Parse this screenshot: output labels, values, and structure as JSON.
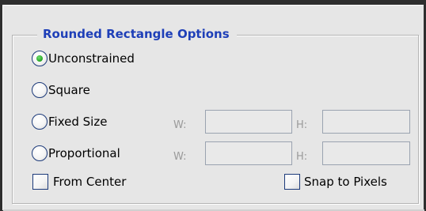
{
  "group": {
    "title": "Rounded Rectangle Options"
  },
  "options": {
    "unconstrained": {
      "label": "Unconstrained",
      "selected": true
    },
    "square": {
      "label": "Square",
      "selected": false
    },
    "fixed_size": {
      "label": "Fixed Size",
      "selected": false,
      "w_label": "W:",
      "w_value": "",
      "h_label": "H:",
      "h_value": ""
    },
    "proportional": {
      "label": "Proportional",
      "selected": false,
      "w_label": "W:",
      "w_value": "",
      "h_label": "H:",
      "h_value": ""
    }
  },
  "checkboxes": {
    "from_center": {
      "label": "From Center",
      "checked": false
    },
    "snap_to_pixels": {
      "label": "Snap to Pixels",
      "checked": false
    }
  },
  "colors": {
    "title": "#1e3fb8",
    "radio_selected_dot": "#23a323",
    "panel_background": "#e6e6e6"
  }
}
